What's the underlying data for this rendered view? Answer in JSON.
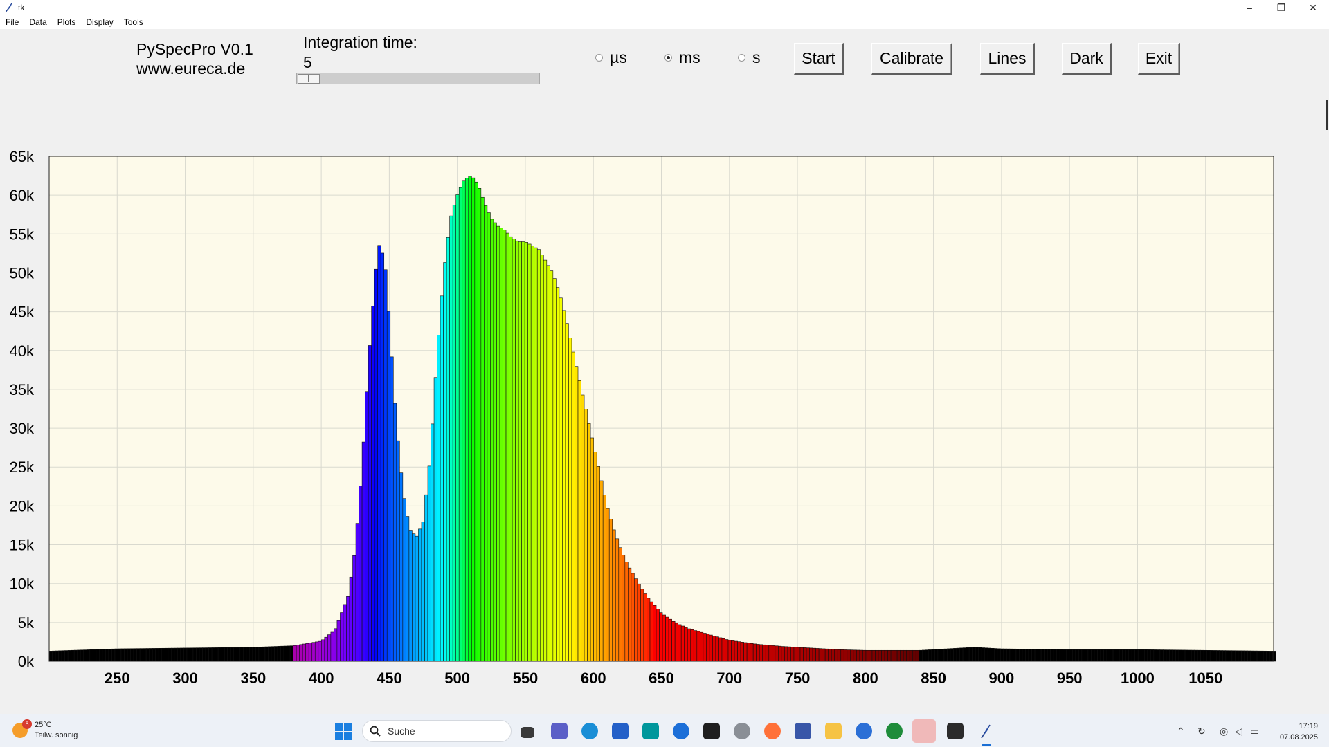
{
  "window": {
    "title": "tk"
  },
  "menu": [
    "File",
    "Data",
    "Plots",
    "Display",
    "Tools"
  ],
  "toolbar": {
    "app_name": "PySpecPro V0.1",
    "website": "www.eureca.de",
    "integration_label": "Integration time:",
    "integration_value": "5",
    "slider_fraction": 0.0,
    "units": [
      {
        "label": "µs",
        "selected": false
      },
      {
        "label": "ms",
        "selected": true
      },
      {
        "label": "s",
        "selected": false
      }
    ],
    "buttons": {
      "start": "Start",
      "calibrate": "Calibrate",
      "lines": "Lines",
      "dark": "Dark",
      "exit": "Exit"
    }
  },
  "chart_data": {
    "type": "bar",
    "background": "#fdfaea",
    "grid": true,
    "xlim": [
      200,
      1100
    ],
    "ylim": [
      0,
      65000
    ],
    "xticks": [
      250,
      300,
      350,
      400,
      450,
      500,
      550,
      600,
      650,
      700,
      750,
      800,
      850,
      900,
      950,
      1000,
      1050
    ],
    "yticks": [
      "0k",
      "5k",
      "10k",
      "15k",
      "20k",
      "25k",
      "30k",
      "35k",
      "40k",
      "45k",
      "50k",
      "55k",
      "60k",
      "65k"
    ],
    "bar_colors": "wavelength-spectrum (violet ~380 nm to dark red ~780 nm, black outside)",
    "x": [
      200,
      250,
      300,
      350,
      380,
      400,
      410,
      420,
      425,
      430,
      435,
      440,
      443,
      447,
      450,
      455,
      460,
      465,
      470,
      475,
      480,
      485,
      490,
      495,
      500,
      505,
      510,
      513,
      516,
      520,
      525,
      530,
      535,
      540,
      545,
      550,
      555,
      560,
      565,
      570,
      575,
      580,
      585,
      590,
      595,
      600,
      605,
      610,
      615,
      620,
      625,
      630,
      635,
      640,
      645,
      650,
      660,
      670,
      680,
      690,
      700,
      720,
      740,
      760,
      780,
      800,
      840,
      880,
      900,
      950,
      1000,
      1050,
      1100
    ],
    "values": [
      1300,
      1600,
      1700,
      1800,
      2000,
      2600,
      4000,
      8500,
      14500,
      25000,
      39000,
      50000,
      54000,
      51000,
      44000,
      31000,
      22000,
      17000,
      16000,
      18000,
      26000,
      39000,
      50000,
      57000,
      60000,
      62000,
      62500,
      62000,
      61000,
      59000,
      57000,
      56000,
      55500,
      54500,
      54000,
      54000,
      53500,
      53000,
      51500,
      50000,
      47500,
      44000,
      40000,
      36000,
      32000,
      28000,
      24000,
      20000,
      17000,
      14500,
      12500,
      11000,
      9500,
      8200,
      7200,
      6200,
      5000,
      4200,
      3700,
      3200,
      2700,
      2200,
      1900,
      1700,
      1500,
      1400,
      1400,
      1800,
      1600,
      1500,
      1500,
      1400,
      1300
    ]
  },
  "taskbar": {
    "weather_temp": "25°C",
    "weather_desc": "Teilw. sonnig",
    "weather_badge": "5",
    "search_placeholder": "Suche",
    "time": "17:19",
    "date": "07.08.2025"
  }
}
